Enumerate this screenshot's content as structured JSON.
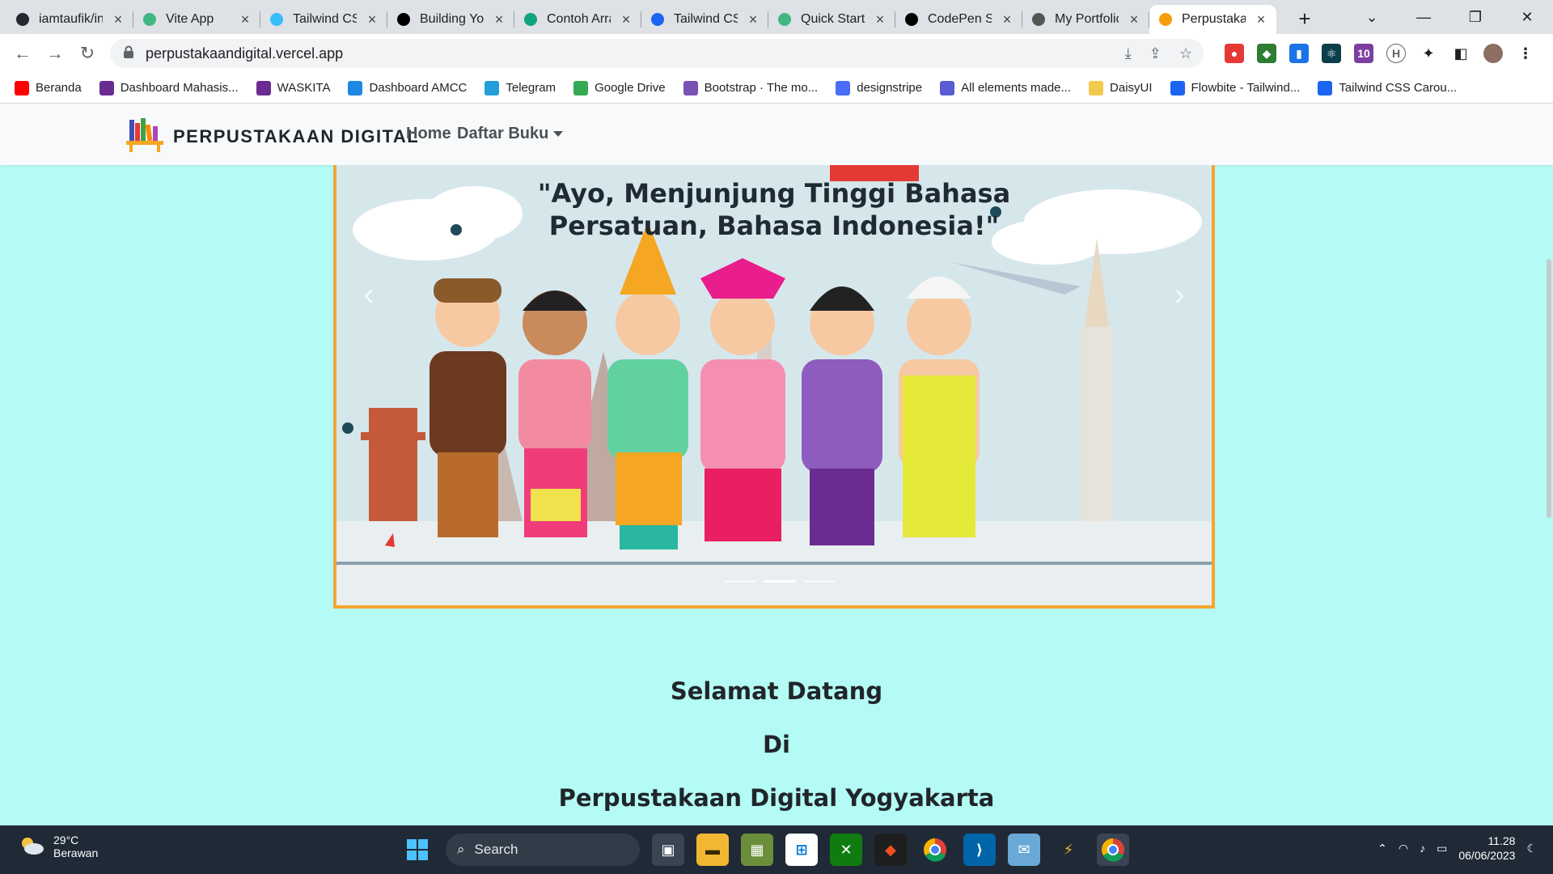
{
  "browser": {
    "tabs": [
      {
        "title": "iamtaufik/in",
        "icon": "github-icon",
        "color": "#24292f"
      },
      {
        "title": "Vite App",
        "icon": "vue-icon",
        "color": "#41b883"
      },
      {
        "title": "Tailwind CSS",
        "icon": "tailwind-icon",
        "color": "#38bdf8"
      },
      {
        "title": "Building You",
        "icon": "nextjs-icon",
        "color": "#000000"
      },
      {
        "title": "Contoh Arra",
        "icon": "chatgpt-icon",
        "color": "#10a37f"
      },
      {
        "title": "Tailwind CSS",
        "icon": "flowbite-icon",
        "color": "#1c64f2"
      },
      {
        "title": "Quick Start",
        "icon": "vue-icon",
        "color": "#41b883"
      },
      {
        "title": "CodePen Se",
        "icon": "codepen-icon",
        "color": "#000000"
      },
      {
        "title": "My Portfolio",
        "icon": "portfolio-icon",
        "color": "#555555"
      },
      {
        "title": "Perpustaka",
        "icon": "books-icon",
        "color": "#f59e0b",
        "active": true
      }
    ],
    "url": "perpustakaandigital.vercel.app",
    "bookmarks": [
      {
        "label": "Beranda",
        "icon": "youtube-icon",
        "color": "#ff0000"
      },
      {
        "label": "Dashboard Mahasis...",
        "icon": "amikom-icon",
        "color": "#6b2c91"
      },
      {
        "label": "WASKITA",
        "icon": "waskita-icon",
        "color": "#6b2c91"
      },
      {
        "label": "Dashboard AMCC",
        "icon": "amcc-icon",
        "color": "#1e88e5"
      },
      {
        "label": "Telegram",
        "icon": "telegram-icon",
        "color": "#229ed9"
      },
      {
        "label": "Google Drive",
        "icon": "drive-icon",
        "color": "#34a853"
      },
      {
        "label": "Bootstrap · The mo...",
        "icon": "bootstrap-icon",
        "color": "#7952b3"
      },
      {
        "label": "designstripe",
        "icon": "designstripe-icon",
        "color": "#4a6cf7"
      },
      {
        "label": "All elements made...",
        "icon": "uiverse-icon",
        "color": "#5b5bd6"
      },
      {
        "label": "DaisyUI",
        "icon": "daisyui-icon",
        "color": "#f2c94c"
      },
      {
        "label": "Flowbite - Tailwind...",
        "icon": "flowbite-icon",
        "color": "#1c64f2"
      },
      {
        "label": "Tailwind CSS Carou...",
        "icon": "flowbite-icon",
        "color": "#1c64f2"
      }
    ]
  },
  "navbar": {
    "brand": "PERPUSTAKAAN DIGITAL",
    "links": [
      "Home",
      "Daftar Buku"
    ]
  },
  "carousel": {
    "slide_text_1": "\"Ayo, Menjunjung Tinggi Bahasa",
    "slide_text_2": "Persatuan, Bahasa Indonesia!\"",
    "slides": 3,
    "active_slide": 2
  },
  "welcome": {
    "line1": "Selamat Datang",
    "line2": "Di",
    "line3": "Perpustakaan Digital Yogyakarta"
  },
  "taskbar": {
    "temperature": "29°C",
    "weather": "Berawan",
    "search_label": "Search",
    "time": "11.28",
    "date": "06/06/2023"
  }
}
